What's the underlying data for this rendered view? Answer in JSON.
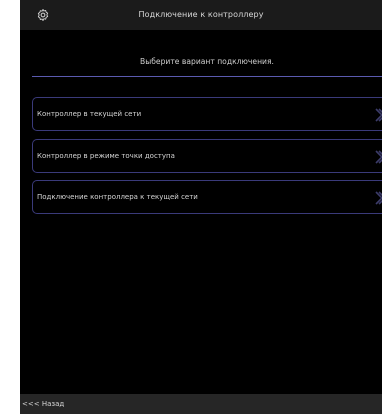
{
  "header": {
    "title": "Подключение к контроллеру",
    "settings_icon": "gear-icon"
  },
  "main": {
    "subtitle": "Выберите вариант подключения.",
    "options": [
      {
        "label": "Контроллер в текущей сети",
        "icon": "chevron-right-icon"
      },
      {
        "label": "Контроллер в режиме точки доступа",
        "icon": "chevron-right-icon"
      },
      {
        "label": "Подключение контроллера к текущей сети",
        "icon": "chevron-right-icon"
      }
    ]
  },
  "footer": {
    "back_label": "<<< Назад"
  },
  "colors": {
    "background": "#000000",
    "header": "#1b1b1b",
    "footer": "#262626",
    "accent_border": "#3a3a7a",
    "divider": "#5a5ab0",
    "chevron": "#3c3c6a"
  }
}
